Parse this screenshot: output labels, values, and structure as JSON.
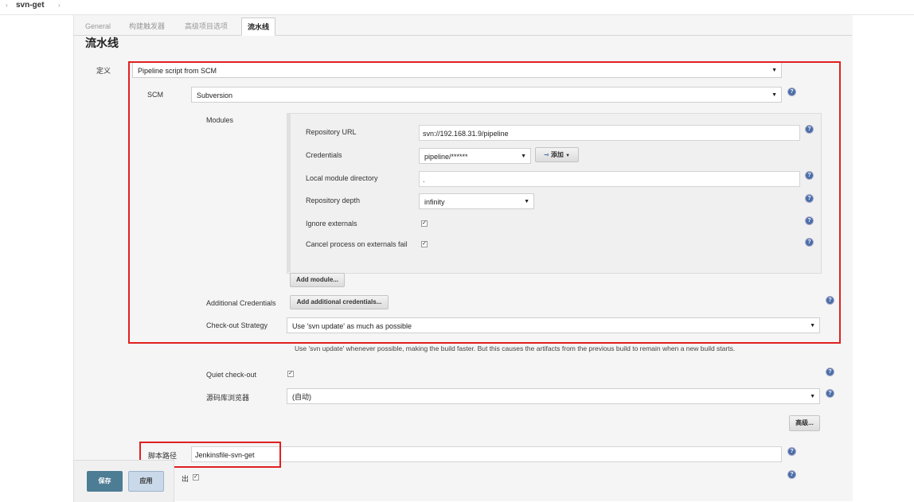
{
  "breadcrumb": {
    "arrow_left": "›",
    "title": "svn-get",
    "arrow_right": "›"
  },
  "tabs": [
    {
      "label": "General",
      "active": false
    },
    {
      "label": "构建触发器",
      "active": false
    },
    {
      "label": "高级项目选项",
      "active": false
    },
    {
      "label": "流水线",
      "active": true
    }
  ],
  "section_title": "流水线",
  "definition": {
    "label": "定义",
    "value": "Pipeline script from SCM"
  },
  "scm": {
    "label": "SCM",
    "value": "Subversion"
  },
  "modules": {
    "label": "Modules",
    "repository_url": {
      "label": "Repository URL",
      "value": "svn://192.168.31.9/pipeline"
    },
    "credentials": {
      "label": "Credentials",
      "value": "pipeline/******",
      "add_label": "添加"
    },
    "local_module_directory": {
      "label": "Local module directory",
      "value": "."
    },
    "repository_depth": {
      "label": "Repository depth",
      "value": "infinity"
    },
    "ignore_externals": {
      "label": "Ignore externals",
      "checked": true
    },
    "cancel_process": {
      "label": "Cancel process on externals fail",
      "checked": true
    },
    "add_module_label": "Add module..."
  },
  "additional_credentials": {
    "label": "Additional Credentials",
    "button": "Add additional credentials..."
  },
  "checkout_strategy": {
    "label": "Check-out Strategy",
    "value": "Use 'svn update' as much as possible",
    "description": "Use 'svn update' whenever possible, making the build faster. But this causes the artifacts from the previous build to remain when a new build starts."
  },
  "quiet_checkout": {
    "label": "Quiet check-out",
    "checked": true
  },
  "repo_browser": {
    "label": "源码库浏览器",
    "value": "(自动)"
  },
  "advanced_label": "高级...",
  "script_path": {
    "label": "脚本路径",
    "value": "Jenkinsfile-svn-get"
  },
  "lightweight": {
    "label_partial": "出",
    "checked": true
  },
  "footer": {
    "save": "保存",
    "apply": "应用"
  },
  "icons": {
    "help": "help-icon",
    "key": "key-icon",
    "caret": "caret-down-icon"
  },
  "colors": {
    "highlight": "#e02020",
    "save": "#4d7c95",
    "help": "#4a6ea8"
  }
}
